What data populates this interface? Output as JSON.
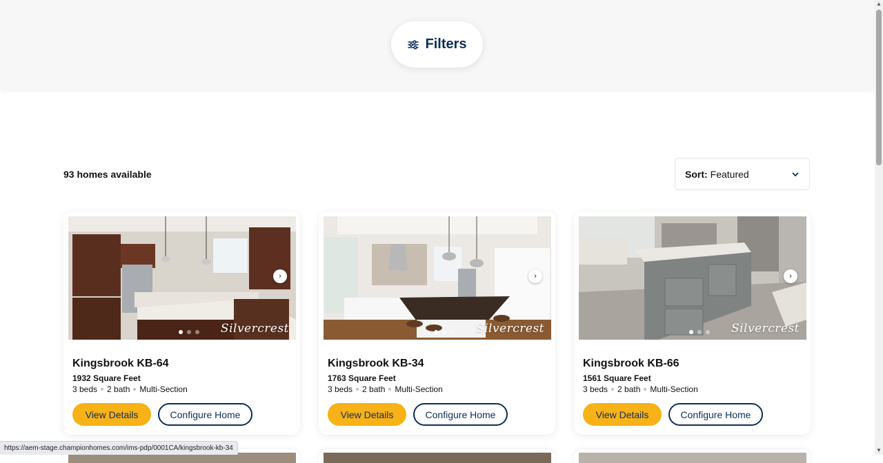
{
  "filters": {
    "label": "Filters",
    "icon": "sliders-icon"
  },
  "results": {
    "count_text": "93 homes available"
  },
  "sort": {
    "label": "Sort:",
    "value": "Featured",
    "icon": "chevron-down-icon"
  },
  "listings": [
    {
      "title": "Kingsbrook KB-64",
      "sqft": "1932 Square Feet",
      "beds": "3 beds",
      "bath": "2 bath",
      "type": "Multi-Section",
      "brand": "Silvercrest",
      "details_label": "View Details",
      "configure_label": "Configure Home"
    },
    {
      "title": "Kingsbrook KB-34",
      "sqft": "1763 Square Feet",
      "beds": "3 beds",
      "bath": "2 bath",
      "type": "Multi-Section",
      "brand": "Silvercrest",
      "details_label": "View Details",
      "configure_label": "Configure Home"
    },
    {
      "title": "Kingsbrook KB-66",
      "sqft": "1561 Square Feet",
      "beds": "3 beds",
      "bath": "2 bath",
      "type": "Multi-Section",
      "brand": "Silvercrest",
      "details_label": "View Details",
      "configure_label": "Configure Home"
    }
  ],
  "status_bar": {
    "url": "https://aem-stage.championhomes.com/ims-pdp/0001CA/kingsbrook-kb-34"
  },
  "colors": {
    "primary": "#0c2d57",
    "accent": "#f7b218",
    "band": "#f7f7f8"
  }
}
